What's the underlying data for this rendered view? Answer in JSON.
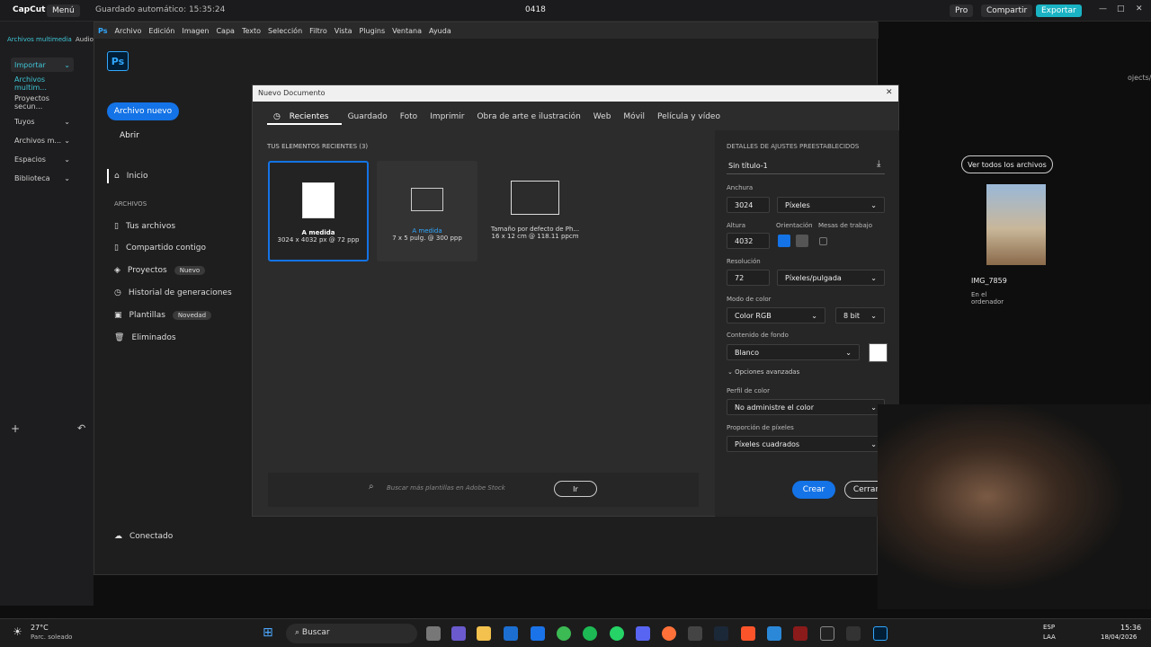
{
  "capcut": {
    "brand": "CapCut",
    "menu": "Menú",
    "autosave": "Guardado automático: 15:35:24",
    "project": "0418",
    "pro": "Pro",
    "share": "Compartir",
    "export": "Exportar",
    "media_tab": "Archivos multimedia",
    "audio_tab": "Audio",
    "side": [
      "Importar",
      "Archivos multim...",
      "Proyectos secun...",
      "Tuyos",
      "Archivos m...",
      "Espacios",
      "Biblioteca"
    ],
    "right_partial": "ojects/"
  },
  "ps": {
    "logo": "Ps",
    "menu": [
      "Archivo",
      "Edición",
      "Imagen",
      "Capa",
      "Texto",
      "Selección",
      "Filtro",
      "Vista",
      "Plugins",
      "Ventana",
      "Ayuda"
    ],
    "new_file": "Archivo nuevo",
    "open": "Abrir",
    "home": "Inicio",
    "files_header": "ARCHIVOS",
    "nav": [
      {
        "label": "Tus archivos"
      },
      {
        "label": "Compartido contigo"
      },
      {
        "label": "Proyectos",
        "tag": "Nuevo"
      },
      {
        "label": "Historial de generaciones"
      },
      {
        "label": "Plantillas",
        "tag": "Novedad"
      },
      {
        "label": "Eliminados"
      }
    ],
    "connected": "Conectado",
    "view_all": "Ver todos los archivos",
    "img_name": "IMG_7859",
    "img_loc": "En el ordenador",
    "img_loc_partial": "enador"
  },
  "dialog": {
    "title": "Nuevo Documento",
    "tabs": [
      "Recientes",
      "Guardado",
      "Foto",
      "Imprimir",
      "Obra de arte e ilustración",
      "Web",
      "Móvil",
      "Película y vídeo"
    ],
    "recent_header": "TUS ELEMENTOS RECIENTES",
    "recent_count": "(3)",
    "items": [
      {
        "name": "A medida",
        "size": "3024 x 4032 px @ 72 ppp"
      },
      {
        "name": "A medida",
        "size": "7 x 5 pulg. @ 300 ppp"
      },
      {
        "name": "Tamaño por defecto de Ph...",
        "size": "16 x 12 cm @ 118.11 ppcm"
      }
    ],
    "search_placeholder": "Buscar más plantillas en Adobe Stock",
    "go": "Ir",
    "preset_header": "DETALLES DE AJUSTES PREESTABLECIDOS",
    "preset_name": "Sin título-1",
    "width_label": "Anchura",
    "width": "3024",
    "unit": "Píxeles",
    "height_label": "Altura",
    "height": "4032",
    "orientation": "Orientación",
    "artboards": "Mesas de trabajo",
    "res_label": "Resolución",
    "res": "72",
    "res_unit": "Píxeles/pulgada",
    "color_mode_label": "Modo de color",
    "color_mode": "Color RGB",
    "bits": "8 bit",
    "bg_label": "Contenido de fondo",
    "bg": "Blanco",
    "advanced": "Opciones avanzadas",
    "profile_label": "Perfil de color",
    "profile": "No administre el color",
    "pixel_label": "Proporción de píxeles",
    "pixel": "Píxeles cuadrados",
    "create": "Crear",
    "close": "Cerrar"
  },
  "taskbar": {
    "temp": "27°C",
    "weather": "Parc. soleado",
    "search": "Buscar",
    "lang1": "ESP",
    "lang2": "LAA",
    "time": "15:36",
    "date": "18/04/2026"
  }
}
